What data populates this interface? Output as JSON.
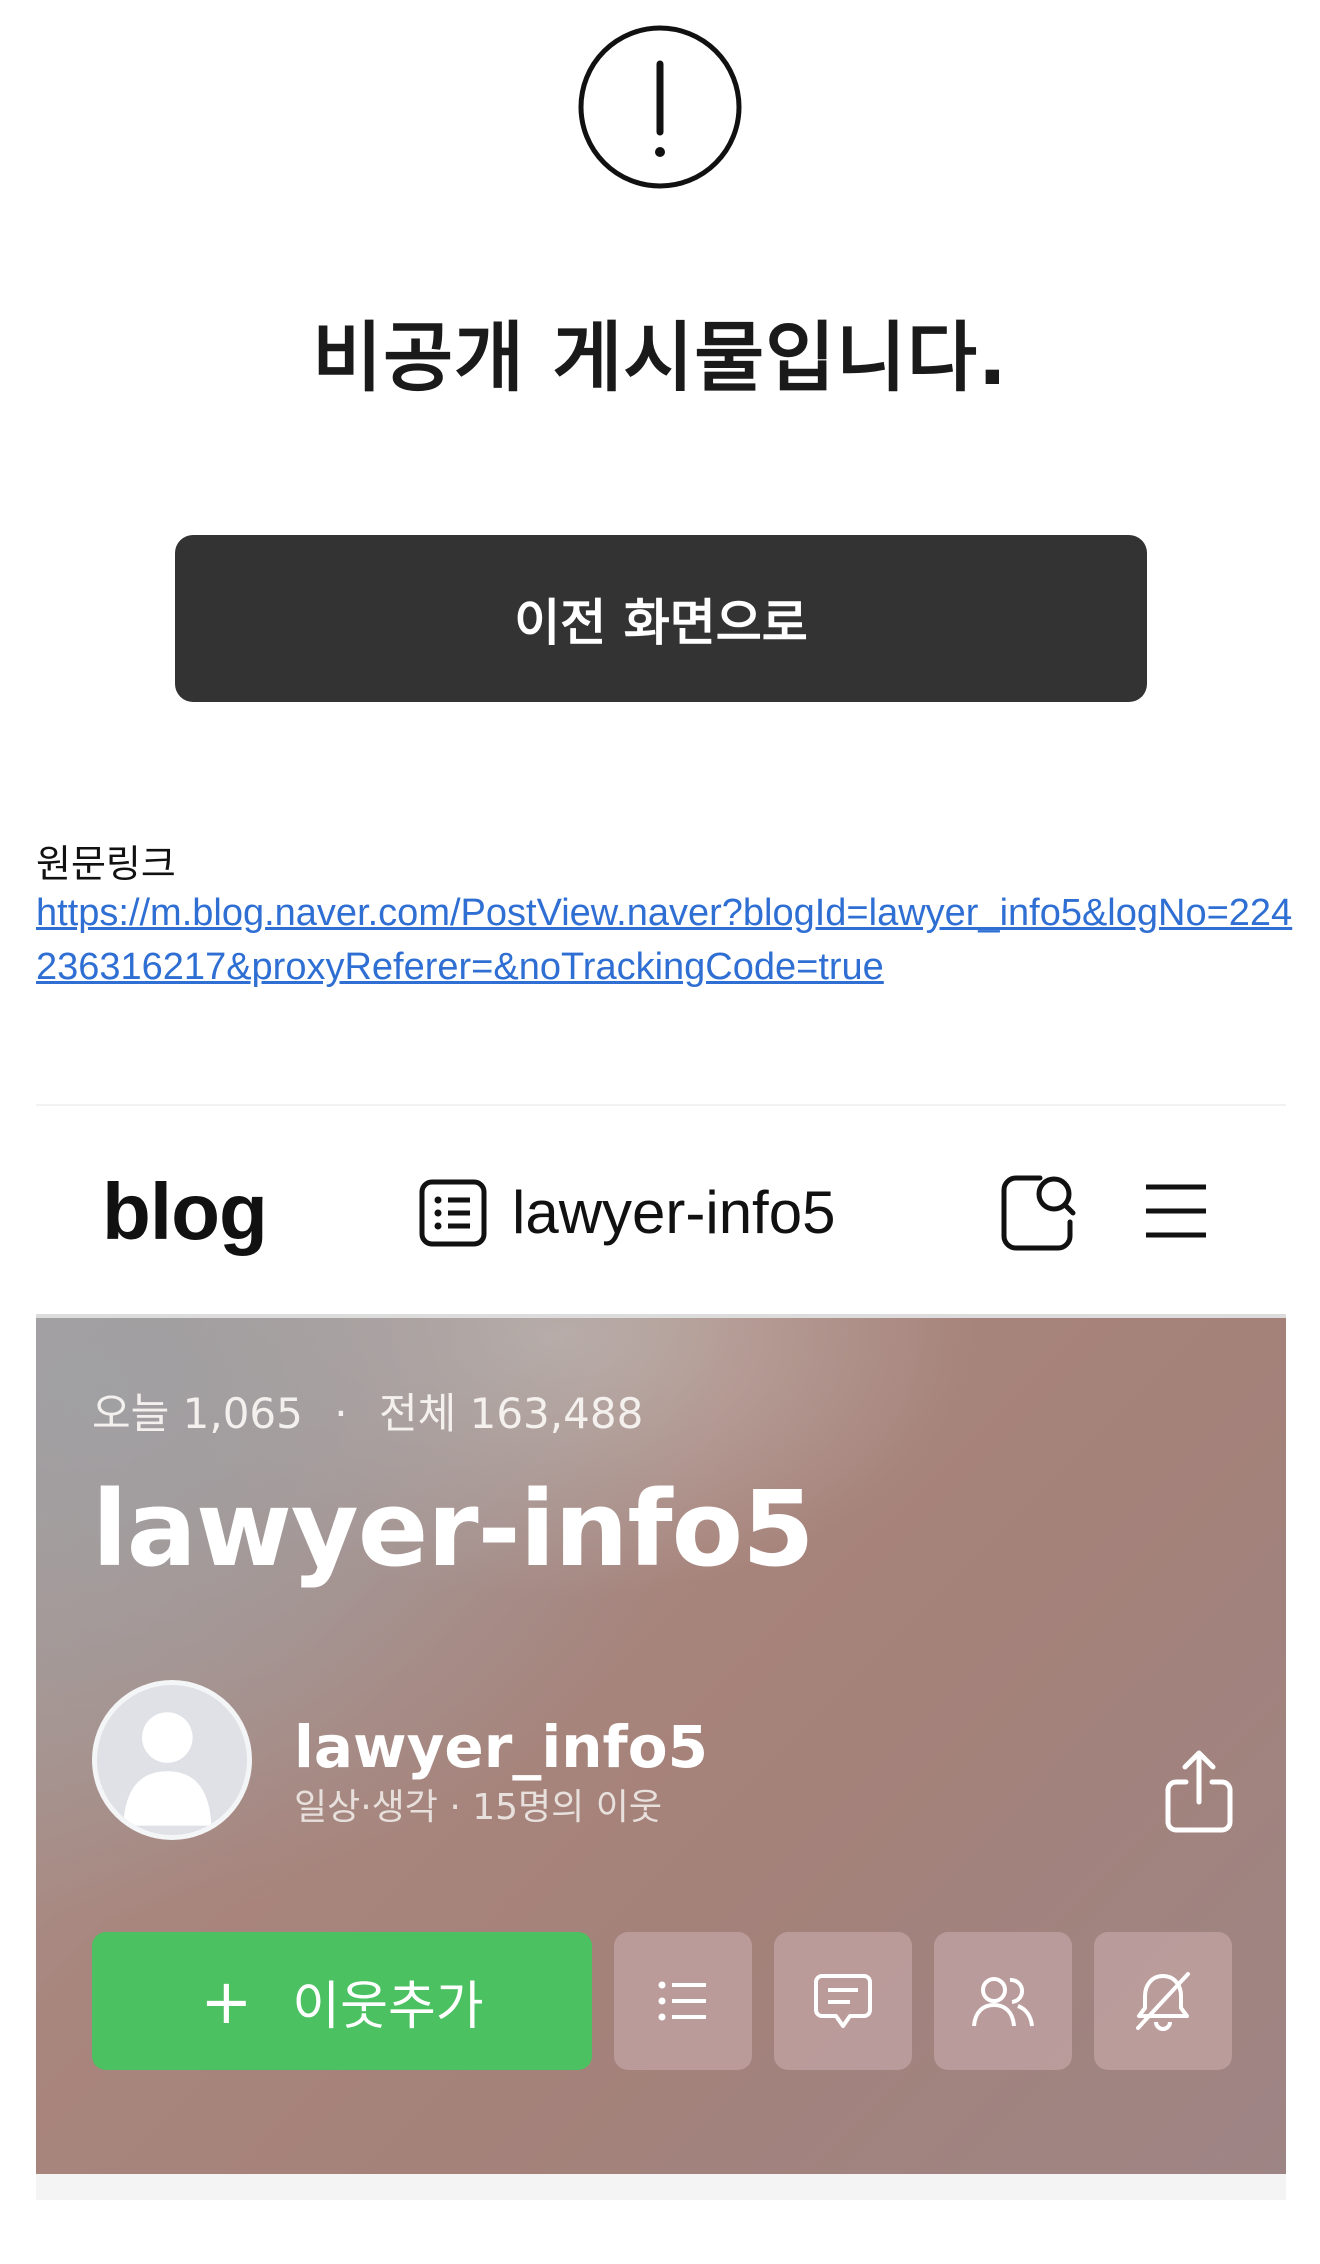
{
  "notice": {
    "icon": "exclamation-circle-icon",
    "title": "비공개 게시물입니다.",
    "back_button_label": "이전 화면으로"
  },
  "original": {
    "label": "원문링크",
    "url": "https://m.blog.naver.com/PostView.naver?blogId=lawyer_info5&logNo=224236316217&proxyReferer=&noTrackingCode=true"
  },
  "header": {
    "logo": "blog",
    "list_icon": "post-list-icon",
    "blog_name": "lawyer-info5",
    "search_icon": "search-icon",
    "menu_icon": "hamburger-menu-icon"
  },
  "banner": {
    "today_label": "오늘",
    "today_count": "1,065",
    "total_label": "전체",
    "total_count": "163,488",
    "title": "lawyer-info5",
    "profile_name": "lawyer_info5",
    "profile_meta": "일상·생각 · 15명의 이웃",
    "share_icon": "share-icon",
    "add_neighbor_label": "이웃추가",
    "accent_green": "#4cc162"
  },
  "actions": [
    {
      "name": "category-list-button",
      "icon": "list-icon"
    },
    {
      "name": "guestbook-button",
      "icon": "comment-icon"
    },
    {
      "name": "neighbors-button",
      "icon": "people-icon"
    },
    {
      "name": "notification-off-button",
      "icon": "bell-off-icon"
    }
  ]
}
